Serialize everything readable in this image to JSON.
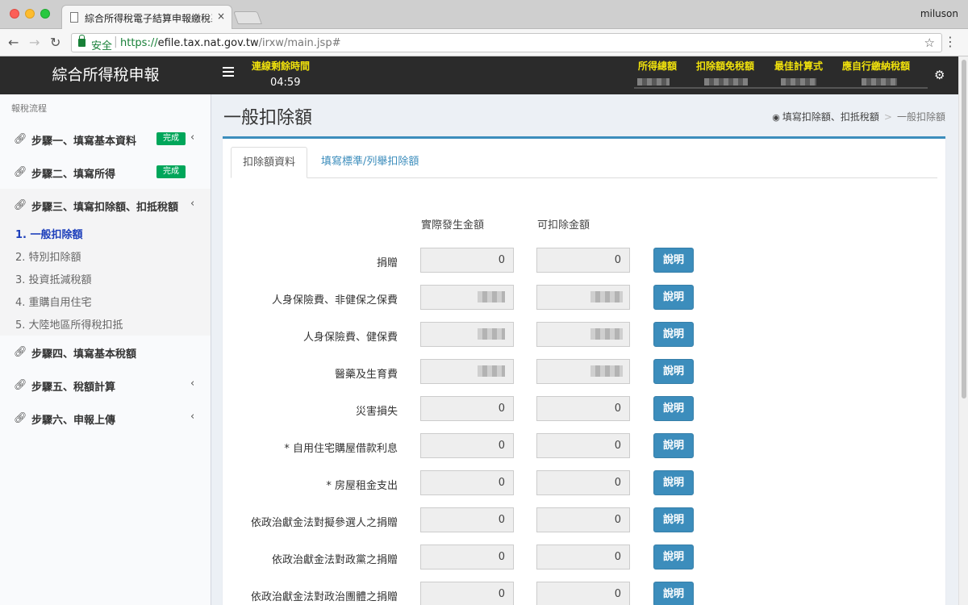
{
  "browser": {
    "tab_title": "綜合所得稅電子結算申報繳稅系統",
    "tab_close": "×",
    "user": "miluson",
    "secure_label": "安全",
    "url_scheme": "https://",
    "url_host": "efile.tax.nat.gov.tw",
    "url_path": "/irxw/main.jsp#"
  },
  "header": {
    "brand": "綜合所得稅申報",
    "timer_label": "連線剩餘時間",
    "timer_value": "04:59",
    "stats": [
      "所得總額",
      "扣除額免稅額",
      "最佳計算式",
      "應自行繳納稅額"
    ]
  },
  "sidebar": {
    "section_label": "報稅流程",
    "done_badge": "完成",
    "steps": [
      {
        "label": "步驟一、填寫基本資料",
        "done": true
      },
      {
        "label": "步驟二、填寫所得",
        "done": true
      },
      {
        "label": "步驟三、填寫扣除額、扣抵稅額",
        "done": false
      },
      {
        "label": "步驟四、填寫基本稅額",
        "done": false
      },
      {
        "label": "步驟五、稅額計算",
        "done": false
      },
      {
        "label": "步驟六、申報上傳",
        "done": false
      }
    ],
    "sub_items": [
      "1. 一般扣除額",
      "2. 特別扣除額",
      "3. 投資抵減稅額",
      "4. 重購自用住宅",
      "5. 大陸地區所得稅扣抵"
    ]
  },
  "content": {
    "title": "一般扣除額",
    "breadcrumb": {
      "parent": "填寫扣除額、扣抵稅額",
      "current": "一般扣除額"
    },
    "tabs": [
      "扣除額資料",
      "填寫標準/列舉扣除額"
    ],
    "columns": [
      "實際發生金額",
      "可扣除金額"
    ],
    "help_label": "說明",
    "rows": [
      {
        "label": "捐贈",
        "actual": "0",
        "deductible": "0"
      },
      {
        "label": "人身保險費、非健保之保費",
        "actual": "",
        "deductible": ""
      },
      {
        "label": "人身保險費、健保費",
        "actual": "",
        "deductible": ""
      },
      {
        "label": "醫藥及生育費",
        "actual": "",
        "deductible": ""
      },
      {
        "label": "災害損失",
        "actual": "0",
        "deductible": "0"
      },
      {
        "label": "* 自用住宅購屋借款利息",
        "actual": "0",
        "deductible": "0"
      },
      {
        "label": "* 房屋租金支出",
        "actual": "0",
        "deductible": "0"
      },
      {
        "label": "依政治獻金法對擬參選人之捐贈",
        "actual": "0",
        "deductible": "0"
      },
      {
        "label": "依政治獻金法對政黨之捐贈",
        "actual": "0",
        "deductible": "0"
      },
      {
        "label": "依政治獻金法對政治團體之捐贈",
        "actual": "0",
        "deductible": "0"
      }
    ]
  }
}
